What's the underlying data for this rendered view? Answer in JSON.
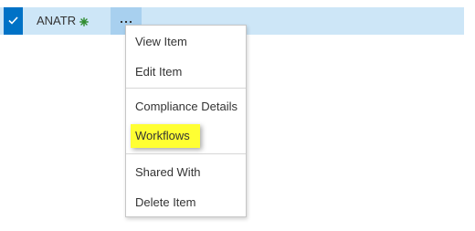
{
  "row": {
    "title": "ANATR",
    "new_icon": "new-item-star-icon",
    "checkmark_icon": "checkmark-icon",
    "ellipsis_icon": "ellipsis-icon"
  },
  "menu": {
    "items": [
      {
        "label": "View Item"
      },
      {
        "label": "Edit Item"
      },
      {
        "label": "Compliance Details"
      },
      {
        "label": "Workflows",
        "highlighted": true
      },
      {
        "label": "Shared With"
      },
      {
        "label": "Delete Item"
      }
    ]
  },
  "colors": {
    "row_selected": "#cde6f7",
    "checkbox_blue": "#0072c6",
    "ellipsis_active": "#a8d0ef",
    "highlight_yellow": "#ffff33",
    "new_icon_green": "#2e8b2e"
  }
}
